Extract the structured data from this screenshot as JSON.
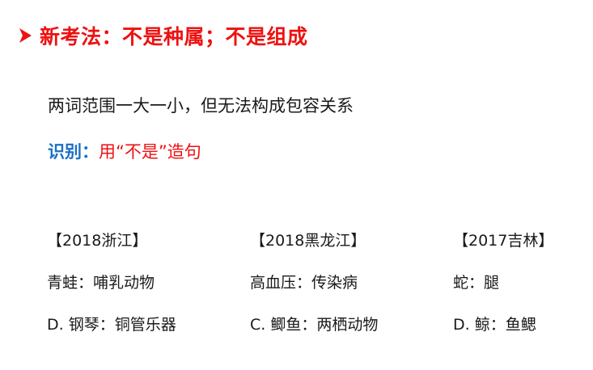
{
  "heading": {
    "text": "新考法：不是种属；不是组成"
  },
  "description": "两词范围一大一小，但无法构成包容关系",
  "identify": {
    "label": "识别：",
    "text": "用“不是”造句"
  },
  "examples": [
    {
      "title": "【2018浙江】",
      "pair": "青蛙：哺乳动物",
      "answer": "D. 钢琴：铜管乐器"
    },
    {
      "title": "【2018黑龙江】",
      "pair": "高血压：传染病",
      "answer": "C. 鲫鱼：两栖动物"
    },
    {
      "title": "【2017吉林】",
      "pair": "蛇：腿",
      "answer": "D. 鲸：鱼鳃"
    }
  ],
  "colors": {
    "heading": "#ee1111",
    "identify_label": "#1a6fc4",
    "identify_text": "#ee1111",
    "body_text": "#1a1a1a"
  }
}
